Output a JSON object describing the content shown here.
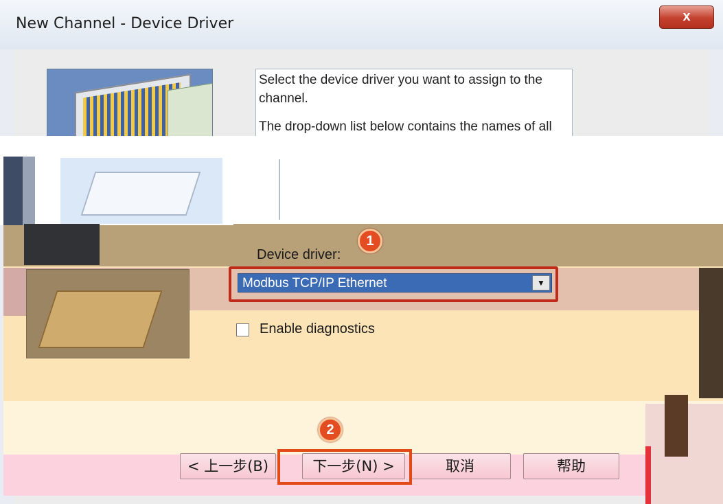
{
  "window": {
    "title": "New Channel - Device Driver",
    "close_label": "x"
  },
  "instructions": {
    "line1": "Select the device driver you want to assign to the channel.",
    "line2": "The drop-down list below contains the names of all the drivers that are installed on your system."
  },
  "device_driver": {
    "label": "Device driver:",
    "selected_value": "Modbus TCP/IP Ethernet"
  },
  "diagnostics": {
    "label": "Enable diagnostics",
    "checked": false
  },
  "buttons": {
    "back": "< 上一步(B)",
    "next": "下一步(N) >",
    "cancel": "取消",
    "help": "帮助"
  },
  "annotations": {
    "step1": "1",
    "step2": "2"
  },
  "colors": {
    "highlight": "#c02a1a",
    "callout": "#e34d21",
    "selection": "#3b6bb5"
  }
}
